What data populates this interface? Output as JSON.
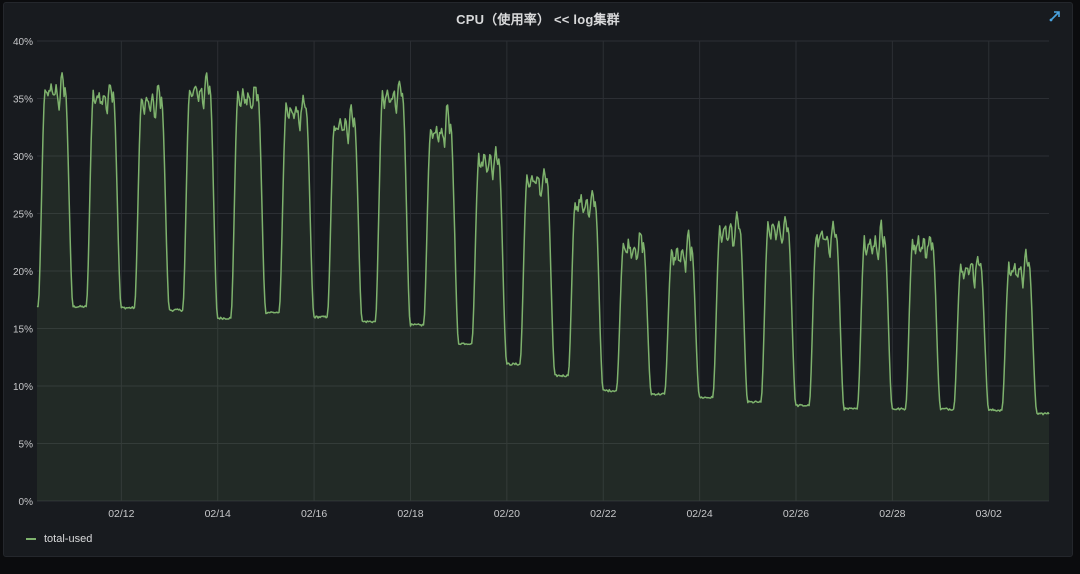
{
  "panel": {
    "title": "CPU（使用率） << log集群",
    "link_icon": "external-link-icon"
  },
  "colors": {
    "background": "#181b1f",
    "grid": "#2c2f34",
    "axis_text": "#c7c8ca",
    "series_line": "#7eb26d",
    "series_fill": "#7eb26d"
  },
  "legend": {
    "items": [
      {
        "label": "total-used",
        "color": "#7eb26d"
      }
    ]
  },
  "chart_data": {
    "type": "area",
    "title": "CPU（使用率） << log集群",
    "xlabel": "",
    "ylabel": "",
    "x_range": [
      "02/10 06:00",
      "03/03 06:00"
    ],
    "x_ticks": [
      "02/12",
      "02/14",
      "02/16",
      "02/18",
      "02/20",
      "02/22",
      "02/24",
      "02/26",
      "02/28",
      "03/02"
    ],
    "y_ticks": [
      "0%",
      "5%",
      "10%",
      "15%",
      "20%",
      "25%",
      "30%",
      "35%",
      "40%"
    ],
    "ylim": [
      0,
      40
    ],
    "y_unit": "%",
    "grid": true,
    "legend_position": "bottom-left",
    "series": [
      {
        "name": "total-used",
        "daily_profile": [
          {
            "date": "02/10",
            "peak": 35.5,
            "peak_max": 36.6,
            "trough_after": 16.9
          },
          {
            "date": "02/11",
            "peak": 35.0,
            "peak_max": 36.3,
            "trough_after": 16.8
          },
          {
            "date": "02/12",
            "peak": 34.5,
            "peak_max": 35.8,
            "trough_after": 16.6
          },
          {
            "date": "02/13",
            "peak": 35.5,
            "peak_max": 37.1,
            "trough_after": 15.9
          },
          {
            "date": "02/14",
            "peak": 35.0,
            "peak_max": 35.8,
            "trough_after": 16.4
          },
          {
            "date": "02/15",
            "peak": 33.8,
            "peak_max": 34.5,
            "trough_after": 16.0
          },
          {
            "date": "02/16",
            "peak": 32.5,
            "peak_max": 34.5,
            "trough_after": 15.6
          },
          {
            "date": "02/17",
            "peak": 35.0,
            "peak_max": 36.2,
            "trough_after": 15.3
          },
          {
            "date": "02/18",
            "peak": 32.0,
            "peak_max": 34.0,
            "trough_after": 13.7
          },
          {
            "date": "02/19",
            "peak": 29.5,
            "peak_max": 30.2,
            "trough_after": 11.9
          },
          {
            "date": "02/20",
            "peak": 27.8,
            "peak_max": 28.2,
            "trough_after": 10.9
          },
          {
            "date": "02/21",
            "peak": 25.8,
            "peak_max": 26.2,
            "trough_after": 9.6
          },
          {
            "date": "02/22",
            "peak": 22.0,
            "peak_max": 23.0,
            "trough_after": 9.3
          },
          {
            "date": "02/23",
            "peak": 21.3,
            "peak_max": 23.0,
            "trough_after": 9.0
          },
          {
            "date": "02/24",
            "peak": 23.3,
            "peak_max": 24.4,
            "trough_after": 8.6
          },
          {
            "date": "02/25",
            "peak": 23.5,
            "peak_max": 24.3,
            "trough_after": 8.3
          },
          {
            "date": "02/26",
            "peak": 22.8,
            "peak_max": 23.8,
            "trough_after": 8.0
          },
          {
            "date": "02/27",
            "peak": 22.3,
            "peak_max": 24.0,
            "trough_after": 8.0
          },
          {
            "date": "02/28",
            "peak": 22.3,
            "peak_max": 22.6,
            "trough_after": 8.0
          },
          {
            "date": "03/01",
            "peak": 20.2,
            "peak_max": 21.1,
            "trough_after": 7.9
          },
          {
            "date": "03/02",
            "peak": 20.0,
            "peak_max": 21.7,
            "trough_after": 7.6
          }
        ]
      }
    ]
  }
}
